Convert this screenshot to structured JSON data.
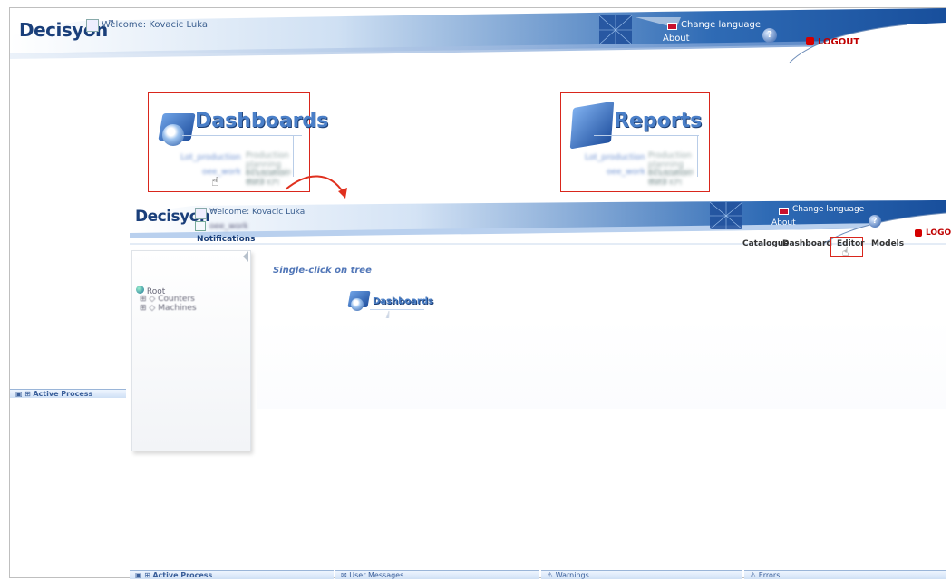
{
  "header": {
    "logo": "Decisyon",
    "welcome": "Welcome: Kovacic Luka",
    "change_language": "Change language",
    "about": "About",
    "logout": "LOGOUT"
  },
  "tiles": {
    "dashboards": {
      "title": "Dashboards",
      "items": [
        {
          "label": "Lot_production",
          "desc": "Production planning evaluation data KPI"
        },
        {
          "label": "oee_work",
          "desc": "KPI analisis work"
        }
      ]
    },
    "reports": {
      "title": "Reports",
      "items": [
        {
          "label": "Lot_production",
          "desc": "Production planning evaluation data KPI"
        },
        {
          "label": "oee_work",
          "desc": "KPI analisis work"
        }
      ]
    }
  },
  "left_panel": {
    "active_process": "Active Process"
  },
  "inner": {
    "logo": "Decisyon",
    "welcome": "Welcome: Kovacic Luka",
    "doc": "oee_work",
    "notifications": "Notifications",
    "change_language": "Change language",
    "about": "About",
    "logout": "LOGOUT",
    "nav": [
      "Catalogue",
      "Dashboard",
      "Editor",
      "Models"
    ],
    "tree": {
      "root": "Root",
      "children": [
        "Counters",
        "Machines"
      ]
    },
    "instruction": "Single-click on tree",
    "dash_title": "Dashboards"
  },
  "status_bar": [
    "Active Process",
    "User Messages",
    "Warnings",
    "Errors"
  ],
  "colors": {
    "accent": "#1a3f7a",
    "highlight": "#d9261c",
    "link": "#4a7fc8"
  }
}
